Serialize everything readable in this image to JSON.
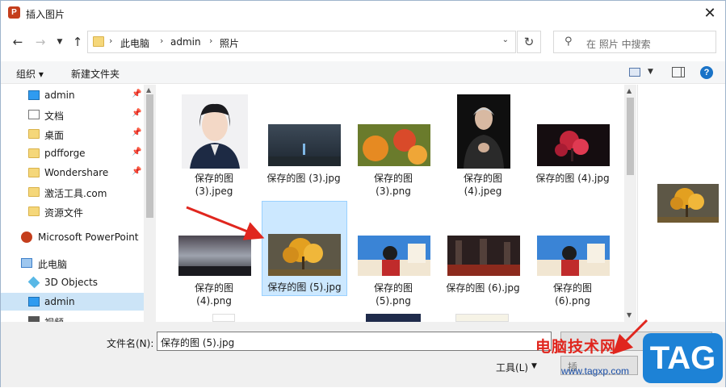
{
  "window": {
    "title": "插入图片",
    "app_icon_letter": "P"
  },
  "nav": {
    "path": [
      "此电脑",
      "admin",
      "照片"
    ],
    "search_placeholder": "在 照片 中搜索"
  },
  "toolbar": {
    "organize": "组织",
    "new_folder": "新建文件夹",
    "help": "?"
  },
  "sidebar": {
    "items": [
      {
        "label": "admin",
        "icon": "desktop-icon",
        "pinned": true
      },
      {
        "label": "文档",
        "icon": "document-icon",
        "pinned": true
      },
      {
        "label": "桌面",
        "icon": "folder-icon",
        "pinned": true
      },
      {
        "label": "pdfforge",
        "icon": "folder-icon",
        "pinned": true
      },
      {
        "label": "Wondershare",
        "icon": "folder-icon",
        "pinned": true
      },
      {
        "label": "激活工具.com",
        "icon": "folder-icon",
        "pinned": false
      },
      {
        "label": "资源文件",
        "icon": "folder-icon",
        "pinned": false
      },
      {
        "label": "Microsoft PowerPoint",
        "icon": "powerpoint-icon",
        "pinned": false
      },
      {
        "label": "此电脑",
        "icon": "computer-icon",
        "pinned": false
      },
      {
        "label": "3D Objects",
        "icon": "3d-objects-icon",
        "pinned": false
      },
      {
        "label": "admin",
        "icon": "desktop-icon",
        "pinned": false,
        "selected": true
      },
      {
        "label": "视频",
        "icon": "video-icon",
        "pinned": false
      }
    ]
  },
  "files": [
    {
      "line1": "保存的图",
      "line2": "(3).jpeg",
      "thumb": "portrait-woman-uniform"
    },
    {
      "line1": "保存的图 (3).jpg",
      "line2": "",
      "thumb": "dark-blue-scene"
    },
    {
      "line1": "保存的图",
      "line2": "(3).png",
      "thumb": "orange-flowers"
    },
    {
      "line1": "保存的图",
      "line2": "(4).jpeg",
      "thumb": "elderly-man-portrait"
    },
    {
      "line1": "保存的图 (4).jpg",
      "line2": "",
      "thumb": "red-tree-dark"
    },
    {
      "line1": "保存的图",
      "line2": "(4).png",
      "thumb": "night-sky-crowd"
    },
    {
      "line1": "保存的图 (5).jpg",
      "line2": "",
      "thumb": "golden-tree",
      "selected": true
    },
    {
      "line1": "保存的图",
      "line2": "(5).png",
      "thumb": "anime-girl-town"
    },
    {
      "line1": "保存的图 (6).jpg",
      "line2": "",
      "thumb": "ruins-dark-red"
    },
    {
      "line1": "保存的图",
      "line2": "(6).png",
      "thumb": "anime-girl-town"
    }
  ],
  "bottom": {
    "filename_label": "文件名(N):",
    "filename_value": "保存的图 (5).jpg",
    "tools_label": "工具(L)",
    "insert_label": "插"
  },
  "watermark": {
    "site_name": "电脑技术网",
    "site_url": "www.tagxp.com",
    "badge": "TAG"
  },
  "colors": {
    "selection": "#cce8ff",
    "accent": "#1d82d6",
    "arrow": "#e0261e"
  }
}
